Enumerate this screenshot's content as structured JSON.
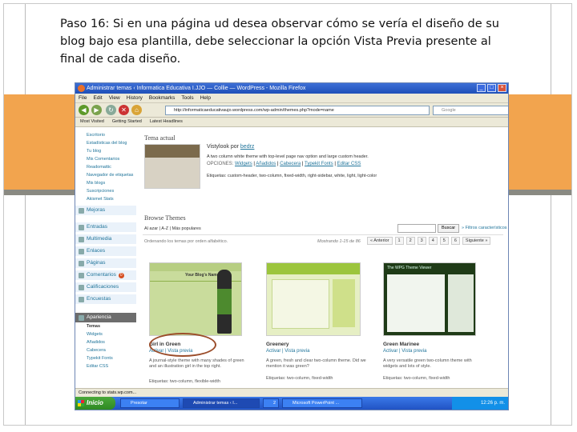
{
  "slide": {
    "caption": "Paso 16: Si en una página ud desea observar cómo se vería el diseño de su blog bajo esa plantilla, debe seleccionar la opción Vista Previa presente al final de cada diseño."
  },
  "browser": {
    "title": "Administrar temas ‹ Informatica Educativa I.JJO — Collie — WordPress - Mozilla Firefox",
    "menu": [
      "File",
      "Edit",
      "View",
      "History",
      "Bookmarks",
      "Tools",
      "Help"
    ],
    "url": "http://informaticaeducativaujo.wordpress.com/wp-admin/themes.php?mode=name",
    "search_placeholder": "Google",
    "bookmarks": [
      "Most Visited",
      "Getting Started",
      "Latest Headlines"
    ],
    "status": "Connecting to stats.wp.com..."
  },
  "sidebar": {
    "items": [
      "Escritorio",
      "Estadísticas del blog",
      "Tu blog",
      "Mis Comentarios",
      "Readomattic",
      "Navegador de etiquetas",
      "Mis blogs",
      "Suscripciones",
      "Akismet Stats"
    ],
    "mejoras": "Mejoras",
    "sections": [
      "Entradas",
      "Multimedia",
      "Enlaces",
      "Páginas",
      "Comentarios",
      "Calificaciones",
      "Encuestas"
    ],
    "comments_badge": "0",
    "appearance": "Apariencia",
    "appearance_items": [
      "Temas",
      "Widgets",
      "Añadidos",
      "Cabecera",
      "Typekit Fonts",
      "Editar CSS"
    ]
  },
  "main": {
    "current_theme_label": "Tema actual",
    "current_theme_name": "Vistylook por",
    "current_theme_author": "bedrz",
    "current_theme_desc": "A two column white theme with top-level page nav option and large custom header.",
    "options_label": "OPCIONES:",
    "options": [
      "Widgets",
      "Añadidos",
      "Cabecera",
      "Typekit Fonts",
      "Editar CSS"
    ],
    "current_theme_tags": "Etiquetas: custom-header, two-column, fixed-width, right-sidebar, white, light, light-color",
    "browse_heading": "Browse Themes",
    "browse_tabs": "Al azar | A-Z | Más populares",
    "search_button": "Buscar",
    "filters_link": "» Filtros característicos",
    "sort_note": "Ordenando los temas por orden alfabético.",
    "showing": "Mostrando 1-15 de 86",
    "pager": [
      "« Anterior",
      "1",
      "2",
      "3",
      "4",
      "5",
      "6",
      "Siguiente »"
    ],
    "themes": [
      {
        "name": "Girl in Green",
        "actions": "Activar | Vista previa",
        "desc": "A journal-style theme with many shades of green and an illustration girl in the top right.",
        "tags": "Etiquetas: two-column, flexible-width",
        "thumb_title": "Your Blog's Name"
      },
      {
        "name": "Greenery",
        "actions": "Activar | Vista previa",
        "desc": "A green, fresh and clear two-column theme. Did we mention it was green?",
        "tags": "Etiquetas: two-column, fixed-width"
      },
      {
        "name": "Green Marinee",
        "actions": "Activar | Vista previa",
        "desc": "A very versatile green two-column theme with widgets and lots of style.",
        "tags": "Etiquetas: two-column, fixed-width",
        "thumb_title": "The WPG Theme Viewer"
      }
    ]
  },
  "taskbar": {
    "start": "Inicio",
    "tasks": [
      "Presotar",
      "Administrar temas ‹ I...",
      "2",
      "Microsoft PowerPoint ..."
    ],
    "clock": "12:26 p. m."
  },
  "colors": {
    "band": "#f2a44e",
    "wp_link": "#21759b",
    "titlebar": "#1e4fb8",
    "annotation_circle": "#9b4d2a"
  }
}
